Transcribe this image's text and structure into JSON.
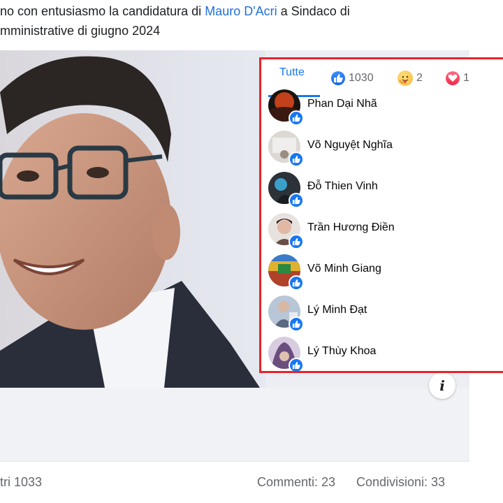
{
  "post": {
    "caption_line1_pre": "no con entusiasmo la candidatura di ",
    "caption_link": "Mauro D'Acri",
    "caption_line1_post": " a Sindaco di",
    "caption_line2": "mministrative di giugno 2024",
    "info_icon": "i"
  },
  "footer": {
    "reactions_text": "tri 1033",
    "comments_text": "Commenti: 23",
    "shares_text": "Condivisioni: 33"
  },
  "reactions_panel": {
    "tabs": [
      {
        "label": "Tutte",
        "active": true
      },
      {
        "icon": "like-icon",
        "count": "1030"
      },
      {
        "icon": "care-icon",
        "count": "2"
      },
      {
        "icon": "love-icon",
        "count": "1"
      }
    ],
    "people": [
      {
        "name": "Phan Dại Nhã",
        "avatar_color": "#7a2a12"
      },
      {
        "name": "Võ Nguyệt Nghĩa",
        "avatar_color": "#d8d4d0"
      },
      {
        "name": "Đỗ Thien Vinh",
        "avatar_color": "#2c3238"
      },
      {
        "name": "Trần Hương Điền",
        "avatar_color": "#6a5046"
      },
      {
        "name": "Võ Minh Giang",
        "avatar_color": "#b0422a"
      },
      {
        "name": "Lý Minh Đạt",
        "avatar_color": "#9aa8bc"
      },
      {
        "name": "Lý Thùy Khoa",
        "avatar_color": "#6a4e7e"
      }
    ]
  },
  "colors": {
    "accent": "#1877f2",
    "highlight_border": "#e8232a",
    "link": "#216fdb"
  }
}
